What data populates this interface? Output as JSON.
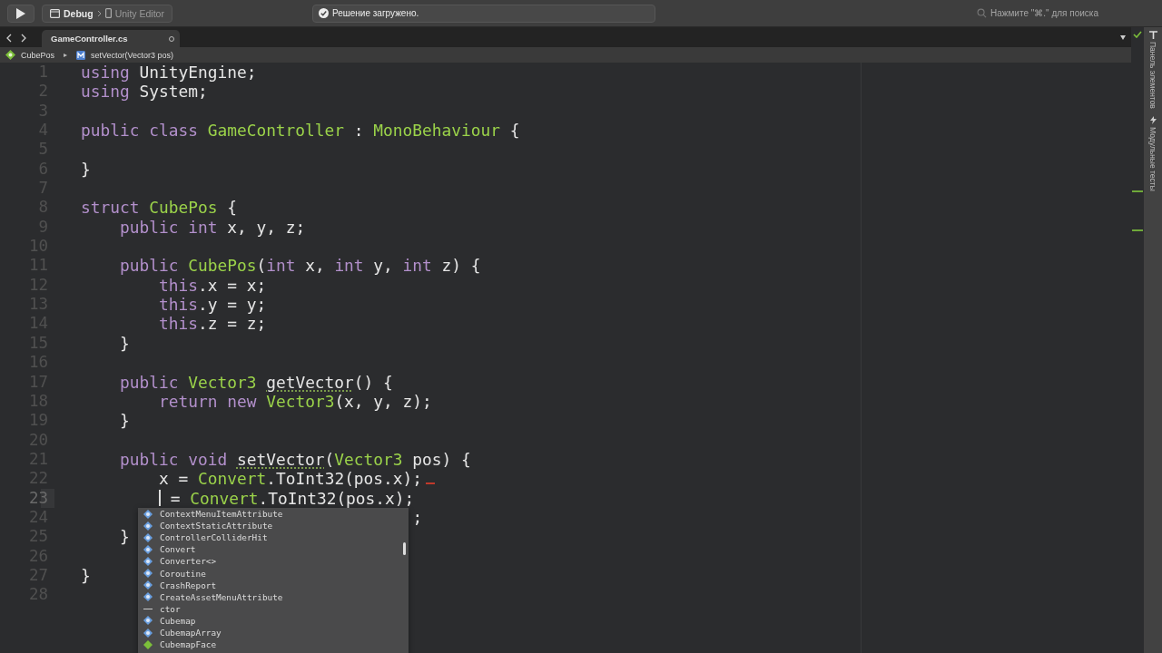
{
  "toolbar": {
    "scheme": {
      "configuration": "Debug",
      "target": "Unity Editor"
    },
    "status": "Решение загружено.",
    "search": {
      "placeholder": "Нажмите \"⌘.\" для поиска"
    }
  },
  "tabs": [
    {
      "label": "GameController.cs",
      "selected": true
    }
  ],
  "breadcrumb": [
    {
      "label": "CubePos",
      "kind": "struct"
    },
    {
      "label": "▸",
      "kind": "separator"
    },
    {
      "label": "setVector(Vector3 pos)",
      "kind": "method"
    }
  ],
  "editor": {
    "lines": [
      {
        "number": "1",
        "current": false,
        "tokens": [
          {
            "text": "using",
            "kind": "keyword"
          },
          {
            "text": " UnityEngine;",
            "kind": "plain"
          }
        ]
      },
      {
        "number": "2",
        "current": false,
        "tokens": [
          {
            "text": "using",
            "kind": "keyword"
          },
          {
            "text": " System;",
            "kind": "plain"
          }
        ]
      },
      {
        "number": "3",
        "current": false
      },
      {
        "number": "4",
        "current": false,
        "tokens": [
          {
            "text": "public class ",
            "kind": "keyword"
          },
          {
            "text": "GameController",
            "kind": "type"
          },
          {
            "text": " : ",
            "kind": "plain"
          },
          {
            "text": "MonoBehaviour",
            "kind": "type"
          },
          {
            "text": " {",
            "kind": "plain"
          }
        ],
        "children": [
          {
            "number": "5",
            "current": false
          }
        ]
      },
      {
        "number": "6",
        "current": false,
        "tokens": [
          {
            "text": "}",
            "kind": "plain"
          }
        ]
      },
      {
        "number": "7",
        "current": false
      },
      {
        "number": "8",
        "current": false,
        "tokens": [
          {
            "text": "struct ",
            "kind": "keyword"
          },
          {
            "text": "CubePos",
            "kind": "type"
          },
          {
            "text": " {",
            "kind": "plain"
          }
        ],
        "children": [
          {
            "number": "9",
            "current": false,
            "tokens": [
              {
                "text": "public int",
                "kind": "keyword"
              },
              {
                "text": " x, y, z;",
                "kind": "plain"
              }
            ]
          },
          {
            "number": "10",
            "current": false
          },
          {
            "number": "11",
            "current": false,
            "tokens": [
              {
                "text": "public ",
                "kind": "keyword"
              },
              {
                "text": "CubePos",
                "kind": "type"
              },
              {
                "text": "(",
                "kind": "plain"
              },
              {
                "text": "int",
                "kind": "keyword"
              },
              {
                "text": " x, ",
                "kind": "plain"
              },
              {
                "text": "int",
                "kind": "keyword"
              },
              {
                "text": " y, ",
                "kind": "plain"
              },
              {
                "text": "int",
                "kind": "keyword"
              },
              {
                "text": " z) {",
                "kind": "plain"
              }
            ],
            "children": [
              {
                "number": "12",
                "current": false,
                "tokens": [
                  {
                    "text": "this",
                    "kind": "keyword"
                  },
                  {
                    "text": ".x = x;",
                    "kind": "plain"
                  }
                ]
              },
              {
                "number": "13",
                "current": false,
                "tokens": [
                  {
                    "text": "this",
                    "kind": "keyword"
                  },
                  {
                    "text": ".y = y;",
                    "kind": "plain"
                  }
                ]
              },
              {
                "number": "14",
                "current": false,
                "tokens": [
                  {
                    "text": "this",
                    "kind": "keyword"
                  },
                  {
                    "text": ".z = z;",
                    "kind": "plain"
                  }
                ]
              }
            ]
          },
          {
            "number": "15",
            "current": false,
            "tokens": [
              {
                "text": "}",
                "kind": "plain"
              }
            ]
          },
          {
            "number": "16",
            "current": false
          },
          {
            "number": "17",
            "current": false,
            "tokens": [
              {
                "text": "public ",
                "kind": "keyword"
              },
              {
                "text": "Vector3 ",
                "kind": "type"
              },
              {
                "text": "getVector",
                "kind": "warning"
              },
              {
                "text": "() {",
                "kind": "plain"
              }
            ],
            "children": [
              {
                "number": "18",
                "current": false,
                "tokens": [
                  {
                    "text": "return new ",
                    "kind": "keyword"
                  },
                  {
                    "text": "Vector3",
                    "kind": "type"
                  },
                  {
                    "text": "(x, y, z);",
                    "kind": "plain"
                  }
                ]
              }
            ]
          },
          {
            "number": "19",
            "current": false,
            "tokens": [
              {
                "text": "}",
                "kind": "plain"
              }
            ]
          },
          {
            "number": "20",
            "current": false
          },
          {
            "number": "21",
            "current": false,
            "tokens": [
              {
                "text": "public void ",
                "kind": "keyword"
              },
              {
                "text": "setVector",
                "kind": "warning"
              },
              {
                "text": "(",
                "kind": "plain"
              },
              {
                "text": "Vector3",
                "kind": "type"
              },
              {
                "text": " pos) {",
                "kind": "plain"
              }
            ],
            "children": [
              {
                "number": "22",
                "current": false,
                "error": true,
                "tokens": [
                  {
                    "text": "x = ",
                    "kind": "plain"
                  },
                  {
                    "text": "Convert",
                    "kind": "type"
                  },
                  {
                    "text": ".ToInt32(pos.x);",
                    "kind": "plain"
                  }
                ]
              },
              {
                "number": "23",
                "current": true,
                "tokens": [
                  {
                    "kind": "caret"
                  },
                  {
                    "text": " = ",
                    "kind": "plain"
                  },
                  {
                    "text": "Convert",
                    "kind": "type"
                  },
                  {
                    "text": ".ToInt32(pos.x);",
                    "kind": "plain"
                  }
                ]
              },
              {
                "number": "24",
                "current": false,
                "kind": "covered",
                "tokens": [
                  {
                    "text": ";",
                    "kind": "plain"
                  }
                ]
              }
            ]
          },
          {
            "number": "25",
            "current": false,
            "tokens": [
              {
                "text": "}",
                "kind": "plain"
              }
            ]
          }
        ]
      },
      {
        "number": "26",
        "current": false
      },
      {
        "number": "27",
        "current": false,
        "tokens": [
          {
            "text": "}",
            "kind": "plain"
          }
        ]
      },
      {
        "number": "28",
        "current": false
      }
    ]
  },
  "completion": {
    "items": [
      {
        "label": "ContextMenuItemAttribute",
        "kind": "class"
      },
      {
        "label": "ContextStaticAttribute",
        "kind": "class"
      },
      {
        "label": "ControllerColliderHit",
        "kind": "class"
      },
      {
        "label": "Convert",
        "kind": "class"
      },
      {
        "label": "Converter<>",
        "kind": "class"
      },
      {
        "label": "Coroutine",
        "kind": "class"
      },
      {
        "label": "CrashReport",
        "kind": "class"
      },
      {
        "label": "CreateAssetMenuAttribute",
        "kind": "class"
      },
      {
        "label": "ctor",
        "kind": "snippet"
      },
      {
        "label": "Cubemap",
        "kind": "class"
      },
      {
        "label": "CubemapArray",
        "kind": "class"
      },
      {
        "label": "CubemapFace",
        "kind": "enum"
      }
    ]
  },
  "side_panel": [
    {
      "label": "Панель элементов",
      "kind": "toolbox"
    },
    {
      "label": "Модульные тесты",
      "kind": "tests"
    }
  ]
}
